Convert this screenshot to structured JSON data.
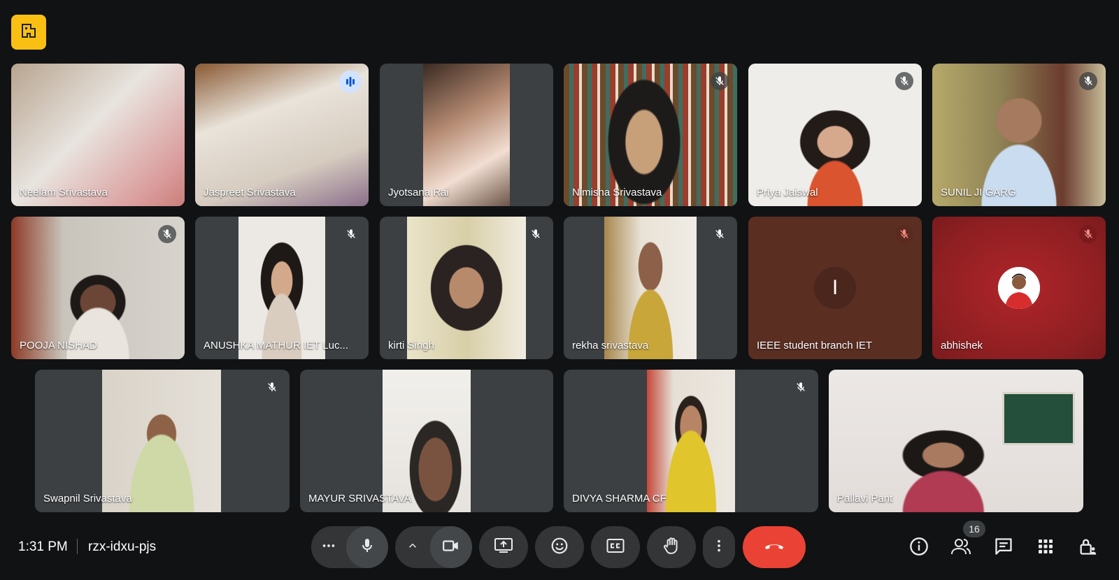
{
  "participants": [
    {
      "name": "Neelam Srivastava"
    },
    {
      "name": "Jaspreet Srivastava"
    },
    {
      "name": "Jyotsana Rai"
    },
    {
      "name": "Nimisha Srivastava"
    },
    {
      "name": "Priya Jaiswal"
    },
    {
      "name": "SUNIL JI GARG"
    },
    {
      "name": "POOJA NISHAD"
    },
    {
      "name": "ANUSHKA MATHUR IET Luc..."
    },
    {
      "name": "kirti Singh"
    },
    {
      "name": "rekha srivastava"
    },
    {
      "name": "IEEE student branch IET",
      "initial": "I"
    },
    {
      "name": "abhishek"
    },
    {
      "name": "Swapnil Srivastava"
    },
    {
      "name": "MAYUR SRIVASTAVA"
    },
    {
      "name": "DIVYA SHARMA CF"
    },
    {
      "name": "Pallavi Pant"
    }
  ],
  "meeting": {
    "time": "1:31 PM",
    "code": "rzx-idxu-pjs",
    "participant_count": "16"
  },
  "colors": {
    "background": "#111214",
    "tile": "#3c4043",
    "accent_yellow": "#f9c013",
    "end_call": "#ea4335",
    "speaking_outline": "#a8c7fa"
  }
}
